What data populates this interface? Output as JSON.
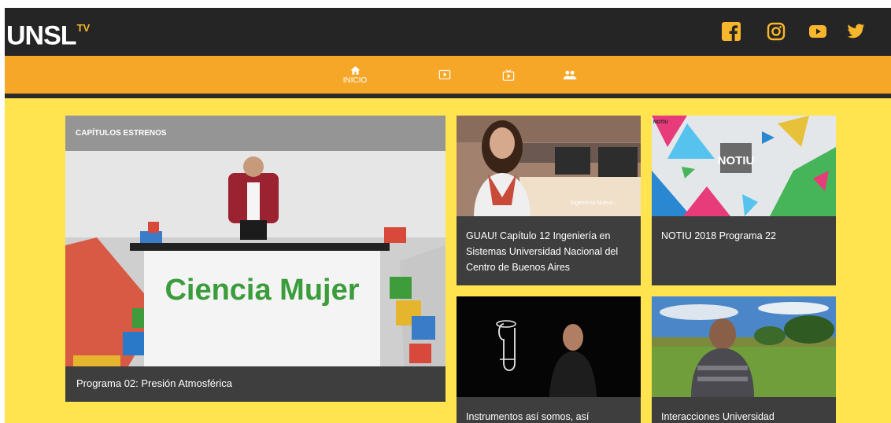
{
  "header": {
    "logo": "UNSL",
    "logo_super": "TV",
    "social": [
      "facebook-icon",
      "instagram-icon",
      "youtube-icon",
      "twitter-icon"
    ]
  },
  "nav": {
    "items": [
      {
        "label": "INICIO",
        "icon": "home-icon"
      },
      {
        "label": "",
        "icon": "play-icon"
      },
      {
        "label": "",
        "icon": "tv-icon"
      },
      {
        "label": "",
        "icon": "people-icon"
      }
    ]
  },
  "featured": {
    "header": "CAPÍTULOS ESTRENOS",
    "image_text": "Ciencia Mujer",
    "title": "Programa 02: Presión Atmosférica"
  },
  "cards": [
    {
      "title": "GUAU! Capítulo 12 Ingeniería en Sistemas Universidad Nacional del Centro de Buenos Aires",
      "overlay": "Ingeniería Nueva..."
    },
    {
      "title": "NOTIU 2018 Programa 22",
      "badge": "NOTIU",
      "corner": "NOTIU"
    },
    {
      "title": "Instrumentos así somos, así"
    },
    {
      "title": "Interacciones Universidad"
    }
  ],
  "colors": {
    "topbar": "#252525",
    "nav": "#f7a728",
    "background": "#ffe44f",
    "card": "#3e3e3e",
    "icons": "#f7b62b"
  }
}
